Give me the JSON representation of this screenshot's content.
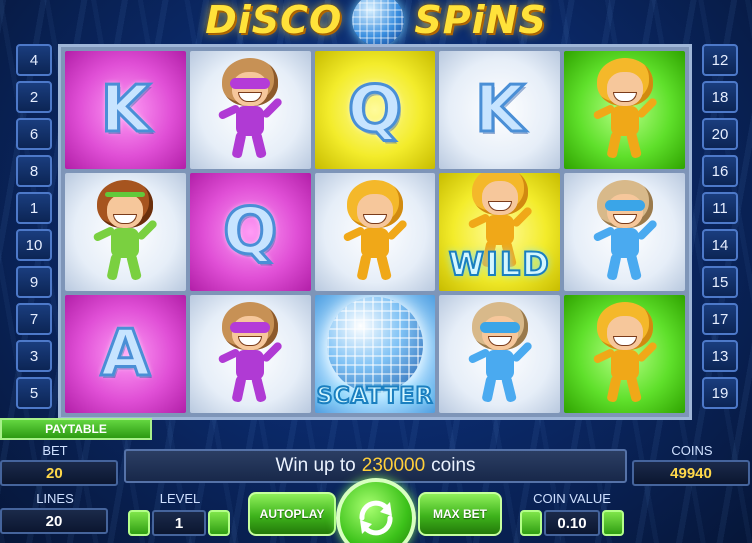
{
  "game": {
    "title_left": "DiSCO",
    "title_right": "SPiNS"
  },
  "paylines": {
    "left": [
      "4",
      "2",
      "6",
      "8",
      "1",
      "10",
      "9",
      "7",
      "3",
      "5"
    ],
    "right": [
      "12",
      "18",
      "20",
      "16",
      "11",
      "14",
      "15",
      "17",
      "13",
      "19"
    ]
  },
  "reels": {
    "wild_label": "WILD",
    "scatter_label": "SCATTER",
    "cells": [
      {
        "symbol": "K",
        "bg": "pink"
      },
      {
        "symbol": "girl-purple",
        "bg": "light"
      },
      {
        "symbol": "Q",
        "bg": "yellow"
      },
      {
        "symbol": "K",
        "bg": "light"
      },
      {
        "symbol": "guy-yellow",
        "bg": "green"
      },
      {
        "symbol": "girl-green",
        "bg": "light"
      },
      {
        "symbol": "Q",
        "bg": "pink"
      },
      {
        "symbol": "guy-yellow",
        "bg": "light"
      },
      {
        "symbol": "wild",
        "bg": "yellow"
      },
      {
        "symbol": "guy-blue",
        "bg": "light"
      },
      {
        "symbol": "A",
        "bg": "pink"
      },
      {
        "symbol": "girl-purple",
        "bg": "light"
      },
      {
        "symbol": "scatter",
        "bg": "sky"
      },
      {
        "symbol": "guy-blue",
        "bg": "light"
      },
      {
        "symbol": "guy-yellow",
        "bg": "green"
      }
    ]
  },
  "panel": {
    "paytable_label": "PAYTABLE",
    "bet_label": "BET",
    "bet_value": "20",
    "coins_label": "COINS",
    "coins_value": "49940",
    "message_prefix": "Win up to",
    "message_amount": "230000",
    "message_suffix": "coins",
    "lines_label": "LINES",
    "lines_value": "20",
    "level_label": "LEVEL",
    "level_value": "1",
    "autoplay_label": "AUTOPLAY",
    "max_bet_label": "MAX BET",
    "coin_value_label": "COIN VALUE",
    "coin_value": "0.10"
  }
}
